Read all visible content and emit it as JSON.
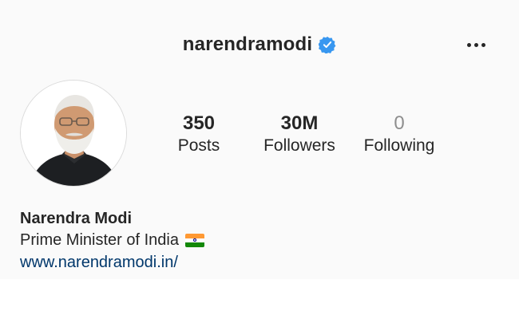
{
  "header": {
    "username": "narendramodi",
    "verified_icon": "verified-badge-icon",
    "more_icon": "more-horizontal-icon"
  },
  "profile": {
    "avatar_icon": "profile-photo",
    "stats": [
      {
        "value": "350",
        "label": "Posts"
      },
      {
        "value": "30M",
        "label": "Followers"
      },
      {
        "value": "0",
        "label": "Following"
      }
    ],
    "full_name": "Narendra Modi",
    "bio_title": "Prime Minister of India",
    "bio_flag_icon": "india-flag-icon",
    "website": "www.narendramodi.in/"
  },
  "colors": {
    "verified_blue": "#3897f0",
    "link": "#00376b",
    "muted": "#8e8e8e"
  }
}
